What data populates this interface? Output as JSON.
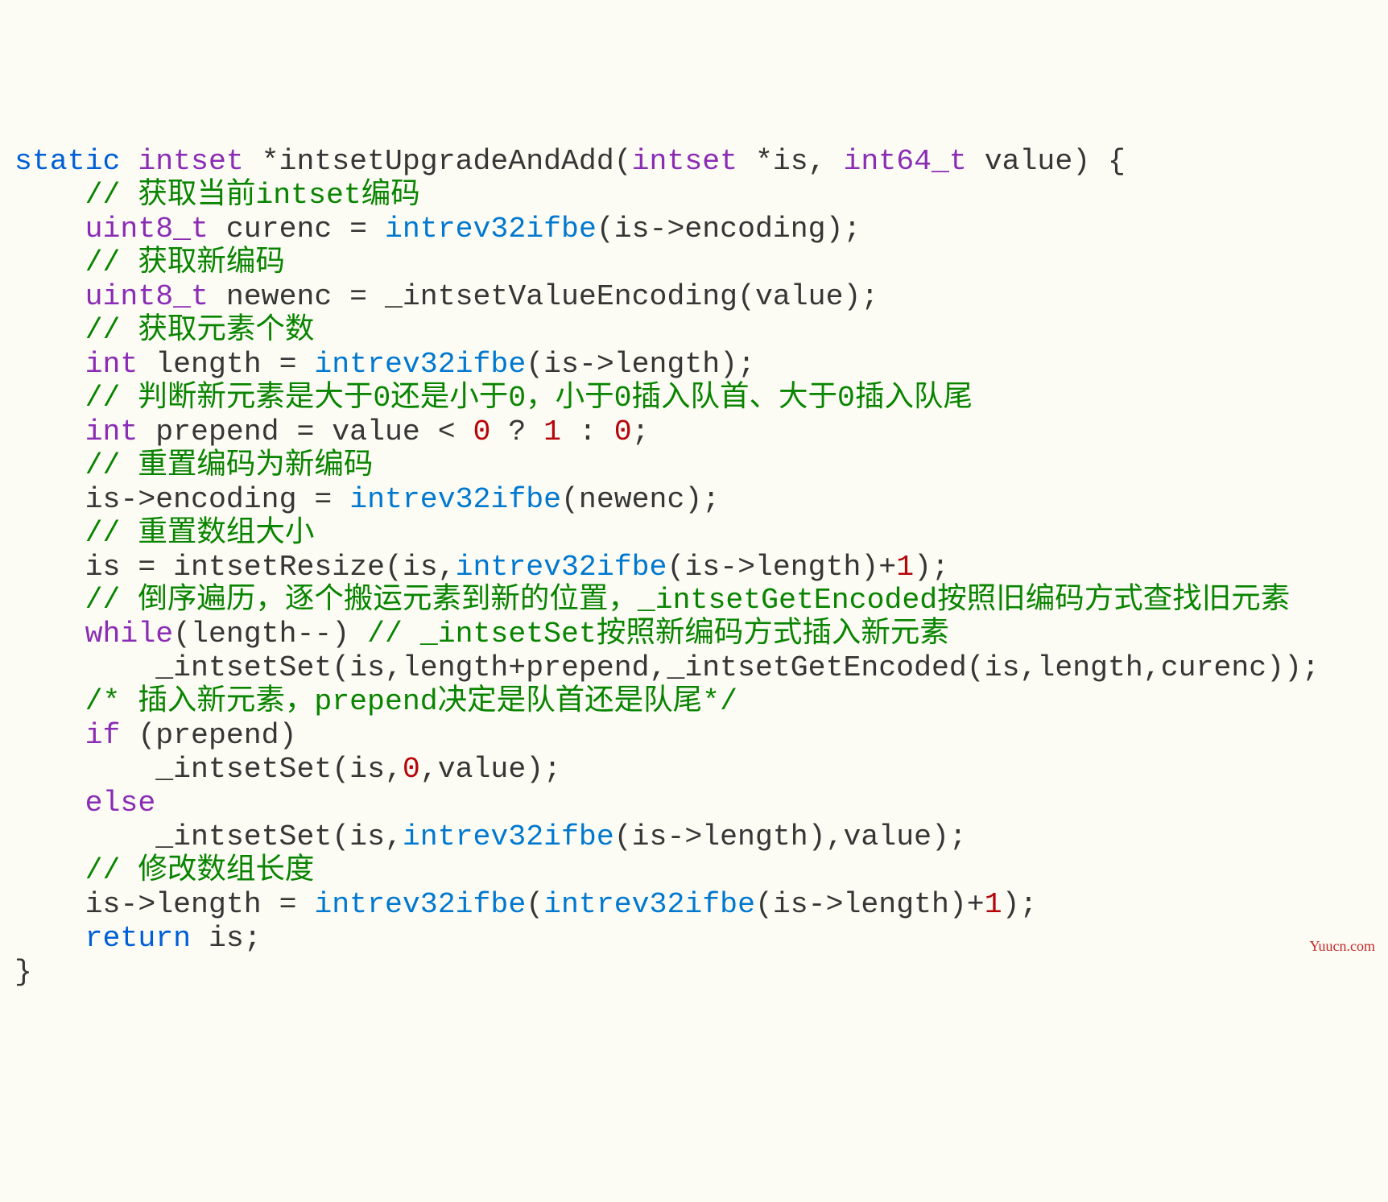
{
  "lines": [
    {
      "indent": 0,
      "tokens": [
        {
          "c": "kw",
          "t": "static"
        },
        {
          "c": "txt",
          "t": " "
        },
        {
          "c": "type",
          "t": "intset"
        },
        {
          "c": "txt",
          "t": " *intsetUpgradeAndAdd("
        },
        {
          "c": "type",
          "t": "intset"
        },
        {
          "c": "txt",
          "t": " *is, "
        },
        {
          "c": "type",
          "t": "int64_t"
        },
        {
          "c": "txt",
          "t": " value) {"
        }
      ]
    },
    {
      "indent": 1,
      "tokens": [
        {
          "c": "com",
          "t": "// 获取当前intset编码"
        }
      ]
    },
    {
      "indent": 1,
      "tokens": [
        {
          "c": "type",
          "t": "uint8_t"
        },
        {
          "c": "txt",
          "t": " curenc = "
        },
        {
          "c": "fn",
          "t": "intrev32ifbe"
        },
        {
          "c": "txt",
          "t": "(is->encoding);"
        }
      ]
    },
    {
      "indent": 1,
      "tokens": [
        {
          "c": "com",
          "t": "// 获取新编码"
        }
      ]
    },
    {
      "indent": 1,
      "tokens": [
        {
          "c": "type",
          "t": "uint8_t"
        },
        {
          "c": "txt",
          "t": " newenc = _intsetValueEncoding(value);"
        }
      ]
    },
    {
      "indent": 1,
      "tokens": [
        {
          "c": "com",
          "t": "// 获取元素个数"
        }
      ]
    },
    {
      "indent": 1,
      "tokens": [
        {
          "c": "type",
          "t": "int"
        },
        {
          "c": "txt",
          "t": " length = "
        },
        {
          "c": "fn",
          "t": "intrev32ifbe"
        },
        {
          "c": "txt",
          "t": "(is->length);"
        }
      ]
    },
    {
      "indent": 1,
      "tokens": [
        {
          "c": "com",
          "t": "// 判断新元素是大于0还是小于0，小于0插入队首、大于0插入队尾"
        }
      ]
    },
    {
      "indent": 1,
      "tokens": [
        {
          "c": "type",
          "t": "int"
        },
        {
          "c": "txt",
          "t": " prepend = value < "
        },
        {
          "c": "num",
          "t": "0"
        },
        {
          "c": "txt",
          "t": " ? "
        },
        {
          "c": "num",
          "t": "1"
        },
        {
          "c": "txt",
          "t": " : "
        },
        {
          "c": "num",
          "t": "0"
        },
        {
          "c": "txt",
          "t": ";"
        }
      ]
    },
    {
      "indent": 1,
      "tokens": [
        {
          "c": "com",
          "t": "// 重置编码为新编码"
        }
      ]
    },
    {
      "indent": 1,
      "tokens": [
        {
          "c": "txt",
          "t": "is->encoding = "
        },
        {
          "c": "fn",
          "t": "intrev32ifbe"
        },
        {
          "c": "txt",
          "t": "(newenc);"
        }
      ]
    },
    {
      "indent": 1,
      "tokens": [
        {
          "c": "com",
          "t": "// 重置数组大小"
        }
      ]
    },
    {
      "indent": 1,
      "tokens": [
        {
          "c": "txt",
          "t": "is = intsetResize(is,"
        },
        {
          "c": "fn",
          "t": "intrev32ifbe"
        },
        {
          "c": "txt",
          "t": "(is->length)+"
        },
        {
          "c": "num",
          "t": "1"
        },
        {
          "c": "txt",
          "t": ");"
        }
      ]
    },
    {
      "indent": 1,
      "tokens": [
        {
          "c": "com",
          "t": "// 倒序遍历，逐个搬运元素到新的位置，_intsetGetEncoded按照旧编码方式查找旧元素"
        }
      ]
    },
    {
      "indent": 1,
      "tokens": [
        {
          "c": "type",
          "t": "while"
        },
        {
          "c": "txt",
          "t": "(length--) "
        },
        {
          "c": "com",
          "t": "// _intsetSet按照新编码方式插入新元素"
        }
      ]
    },
    {
      "indent": 2,
      "tokens": [
        {
          "c": "txt",
          "t": "_intsetSet(is,length+prepend,_intsetGetEncoded(is,length,curenc));"
        }
      ]
    },
    {
      "indent": 1,
      "tokens": [
        {
          "c": "com",
          "t": "/* 插入新元素，prepend决定是队首还是队尾*/"
        }
      ]
    },
    {
      "indent": 1,
      "tokens": [
        {
          "c": "type",
          "t": "if"
        },
        {
          "c": "txt",
          "t": " (prepend)"
        }
      ]
    },
    {
      "indent": 2,
      "tokens": [
        {
          "c": "txt",
          "t": "_intsetSet(is,"
        },
        {
          "c": "num",
          "t": "0"
        },
        {
          "c": "txt",
          "t": ",value);"
        }
      ]
    },
    {
      "indent": 1,
      "tokens": [
        {
          "c": "type",
          "t": "else"
        }
      ]
    },
    {
      "indent": 2,
      "tokens": [
        {
          "c": "txt",
          "t": "_intsetSet(is,"
        },
        {
          "c": "fn",
          "t": "intrev32ifbe"
        },
        {
          "c": "txt",
          "t": "(is->length),value);"
        }
      ]
    },
    {
      "indent": 1,
      "tokens": [
        {
          "c": "com",
          "t": "// 修改数组长度"
        }
      ]
    },
    {
      "indent": 1,
      "tokens": [
        {
          "c": "txt",
          "t": "is->length = "
        },
        {
          "c": "fn",
          "t": "intrev32ifbe"
        },
        {
          "c": "txt",
          "t": "("
        },
        {
          "c": "fn",
          "t": "intrev32ifbe"
        },
        {
          "c": "txt",
          "t": "(is->length)+"
        },
        {
          "c": "num",
          "t": "1"
        },
        {
          "c": "txt",
          "t": ");"
        }
      ]
    },
    {
      "indent": 1,
      "tokens": [
        {
          "c": "kw",
          "t": "return"
        },
        {
          "c": "txt",
          "t": " is;"
        }
      ]
    },
    {
      "indent": 0,
      "tokens": [
        {
          "c": "txt",
          "t": "}"
        }
      ]
    }
  ],
  "watermark": "Yuucn.com"
}
